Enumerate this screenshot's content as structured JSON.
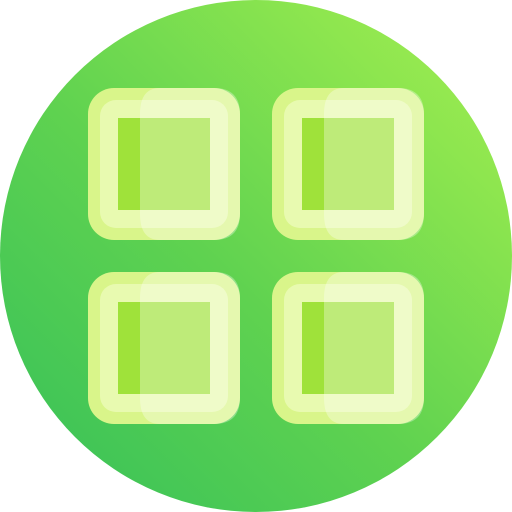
{
  "icon": {
    "name": "grid-app-icon",
    "tile_count": 4,
    "colors": {
      "background_start": "#34c05a",
      "background_end": "#a6ee52",
      "tile_outer": "#e4f7a3",
      "tile_frame": "#d7f57a",
      "tile_inner": "#9ee436",
      "tile_highlight": "#ffffff"
    }
  }
}
